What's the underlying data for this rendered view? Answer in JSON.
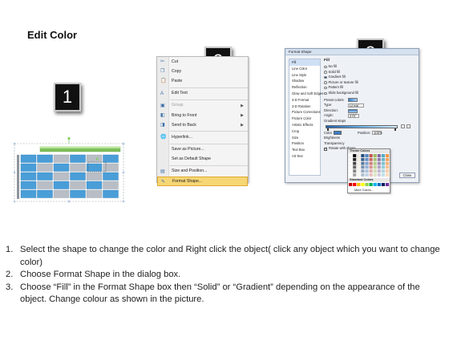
{
  "title": "Edit Color",
  "badges": [
    "1",
    "2",
    "3"
  ],
  "context_menu": {
    "items": [
      {
        "label": "Cut",
        "icon": "scissors-icon",
        "glyph": "✂",
        "disabled": false,
        "submenu": false,
        "highlight": false
      },
      {
        "label": "Copy",
        "icon": "copy-icon",
        "glyph": "❐",
        "disabled": false,
        "submenu": false,
        "highlight": false
      },
      {
        "label": "Paste",
        "icon": "paste-icon",
        "glyph": "📋",
        "disabled": false,
        "submenu": false,
        "highlight": false
      },
      {
        "label": "Edit Text",
        "icon": "edit-text-icon",
        "glyph": "A",
        "disabled": false,
        "submenu": false,
        "highlight": false
      },
      {
        "label": "Group",
        "icon": "group-icon",
        "glyph": "▣",
        "disabled": true,
        "submenu": true,
        "highlight": false
      },
      {
        "label": "Bring to Front",
        "icon": "bring-front-icon",
        "glyph": "◧",
        "disabled": false,
        "submenu": true,
        "highlight": false
      },
      {
        "label": "Send to Back",
        "icon": "send-back-icon",
        "glyph": "◨",
        "disabled": false,
        "submenu": true,
        "highlight": false
      },
      {
        "label": "Hyperlink...",
        "icon": "hyperlink-icon",
        "glyph": "🌐",
        "disabled": false,
        "submenu": false,
        "highlight": false
      },
      {
        "label": "Save as Picture...",
        "icon": "",
        "glyph": "",
        "disabled": false,
        "submenu": false,
        "highlight": false
      },
      {
        "label": "Set as Default Shape",
        "icon": "",
        "glyph": "",
        "disabled": false,
        "submenu": false,
        "highlight": false
      },
      {
        "label": "Size and Position...",
        "icon": "size-position-icon",
        "glyph": "▤",
        "disabled": false,
        "submenu": false,
        "highlight": false
      },
      {
        "label": "Format Shape...",
        "icon": "format-shape-icon",
        "glyph": "✎",
        "disabled": false,
        "submenu": false,
        "highlight": true
      }
    ]
  },
  "format_dialog": {
    "title": "Format Shape",
    "nav": [
      "Fill",
      "Line Color",
      "Line Style",
      "Shadow",
      "Reflection",
      "Glow and Soft Edges",
      "3-D Format",
      "3-D Rotation",
      "Picture Corrections",
      "Picture Color",
      "Artistic Effects",
      "Crop",
      "Size",
      "Position",
      "Text Box",
      "Alt Text"
    ],
    "panel_header": "Fill",
    "fill_options": [
      "No fill",
      "Solid fill",
      "Gradient fill",
      "Picture or texture fill",
      "Pattern fill",
      "Slide background fill"
    ],
    "gradient_rows": [
      "Preset colors:",
      "Type:",
      "Direction:",
      "Angle:",
      "Gradient stops"
    ],
    "type_value": "Linear",
    "angle_value": "270°",
    "color_label": "Color",
    "position_label": "Position:",
    "position_value": "100%",
    "brightness_label": "Brightness",
    "transparency_label": "Transparency",
    "rotate_label": "Rotate with shape",
    "close_label": "Close",
    "palette": {
      "theme_label": "Theme Colors",
      "standard_label": "Standard Colors",
      "more_label": "More Colors..."
    }
  },
  "instructions": [
    {
      "num": "1.",
      "text": "Select the shape to change the color and Right click the object( click any object which you want to change color)"
    },
    {
      "num": "2.",
      "text": "Choose Format Shape in the dialog box."
    },
    {
      "num": "3.",
      "text": "Choose “Fill” in the Format Shape box then “Solid” or “Gradient” depending on the appearance of the object. Change colour as shown in the picture."
    }
  ],
  "colors": {
    "grid_blue": "#4a9ed8",
    "grid_gray": "#b9bec6",
    "grid_top_green": "#7fbf5a",
    "menu_highlight": "#f7d675"
  }
}
